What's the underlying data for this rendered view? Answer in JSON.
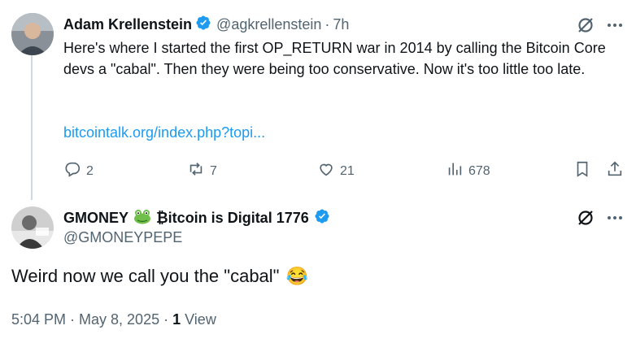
{
  "parent_tweet": {
    "author_name": "Adam Krellenstein",
    "handle": "@agkrellenstein",
    "separator": "·",
    "time": "7h",
    "text": "Here's where I started the first OP_RETURN war in 2014 by calling the Bitcoin Core devs a \"cabal\". Then they were being too conservative. Now it's too little too late.",
    "link": "bitcointalk.org/index.php?topi...",
    "replies": "2",
    "reposts": "7",
    "likes": "21",
    "views": "678"
  },
  "reply_tweet": {
    "author_name": "GMONEY",
    "name_suffix": "₿itcoin is Digital 1776",
    "handle": "@GMONEYPEPE",
    "text": "Weird now we call you the \"cabal\"",
    "emoji": "😂",
    "timestamp": "5:04 PM · May 8, 2025 · ",
    "view_count": "1",
    "view_label": "View"
  },
  "colors": {
    "verified_blue": "#1d9bf0",
    "secondary_text": "#536471",
    "primary_text": "#0f1419"
  },
  "icons": [
    "verified-badge-icon",
    "grok-icon",
    "more-icon",
    "reply-icon",
    "repost-icon",
    "like-icon",
    "views-icon",
    "bookmark-icon",
    "share-icon",
    "frog-emoji-icon",
    "laughing-emoji-icon"
  ]
}
